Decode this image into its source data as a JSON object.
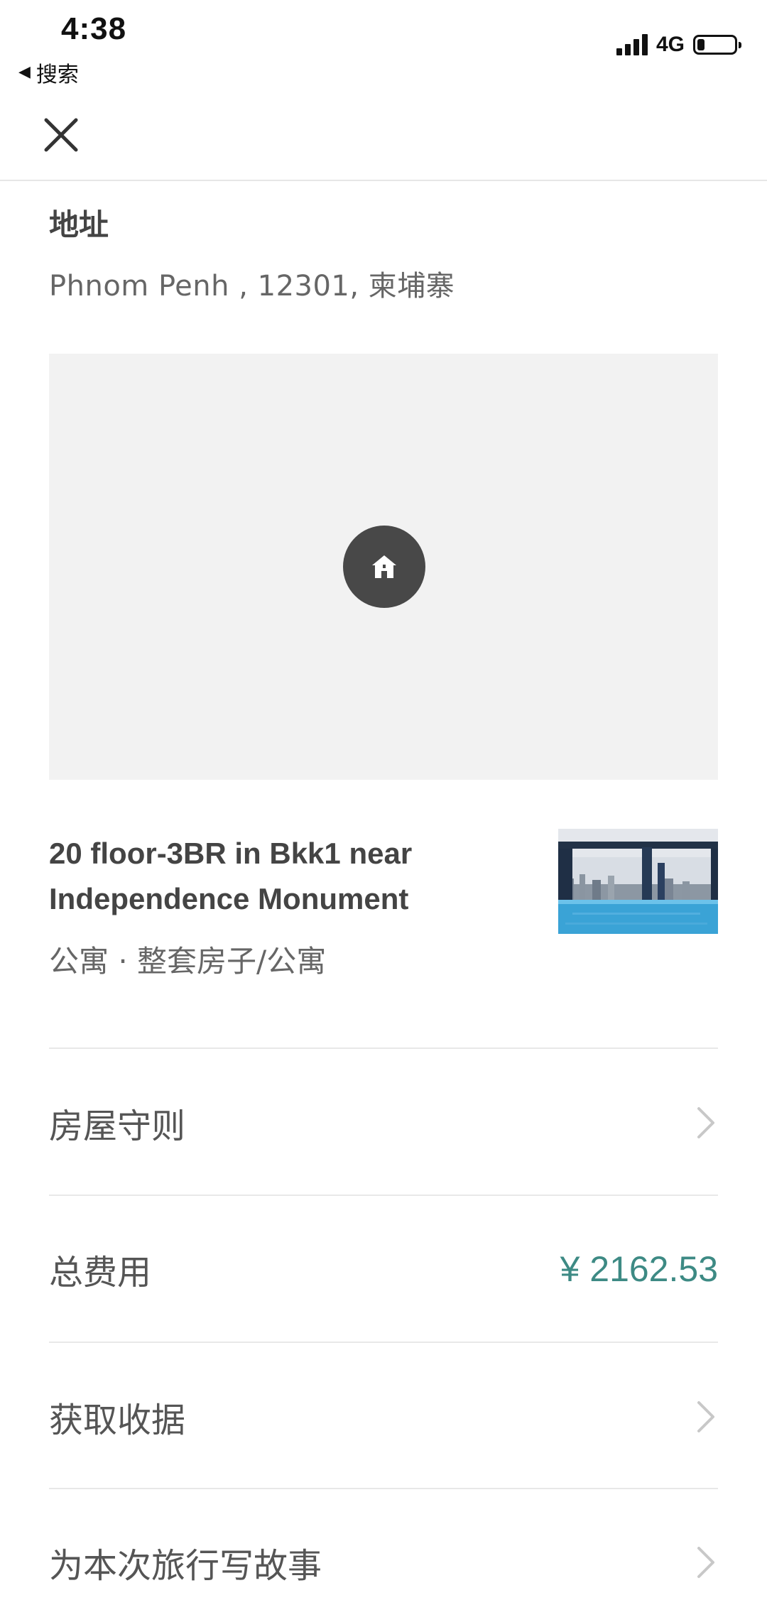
{
  "status_bar": {
    "time": "4:38",
    "back_app_label": "搜索",
    "network": "4G",
    "battery_level": 0.2
  },
  "address": {
    "title": "地址",
    "text": "Phnom Penh , 12301, 柬埔寨"
  },
  "listing": {
    "title": "20 floor-3BR in Bkk1 near Independence Monument",
    "subtitle": "公寓 · 整套房子/公寓"
  },
  "rows": {
    "house_rules": "房屋守则",
    "total_cost_label": "总费用",
    "total_cost_value": "¥ 2162.53",
    "get_receipt": "获取收据",
    "write_story": "为本次旅行写故事"
  },
  "colors": {
    "accent": "#3d8a84",
    "map_bg": "#f2f2f2",
    "pin_bg": "#484848"
  },
  "icons": {
    "close": "close-icon",
    "map_pin": "house-icon",
    "chevron": "chevron-right-icon"
  }
}
